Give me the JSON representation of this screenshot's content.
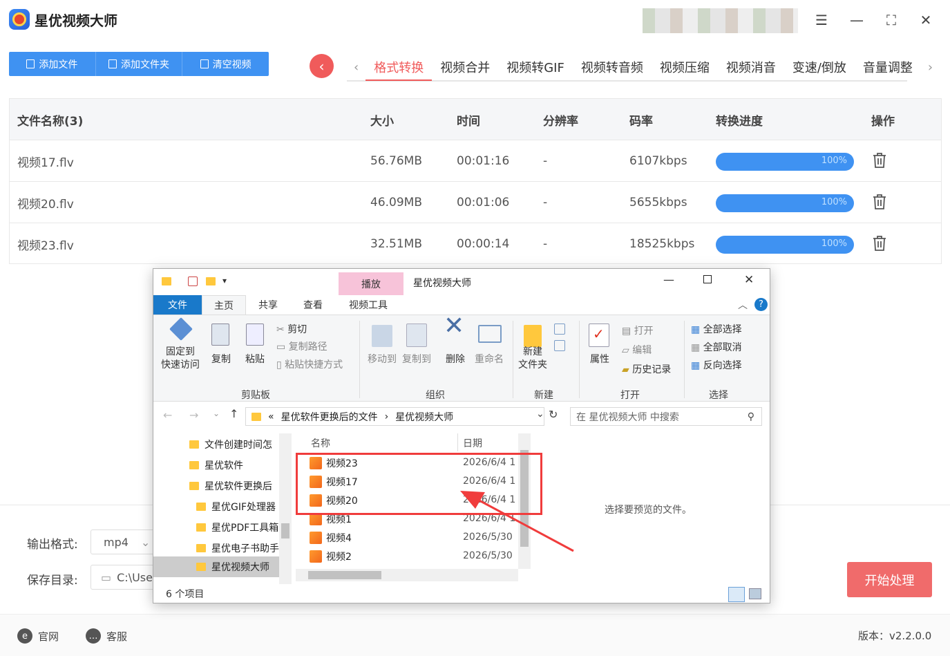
{
  "app": {
    "title": "星优视频大师",
    "version": "版本：v2.2.0.0"
  },
  "toolbar": {
    "add_file": "添加文件",
    "add_folder": "添加文件夹",
    "clear": "清空视频"
  },
  "tabs": [
    "格式转换",
    "视频合并",
    "视频转GIF",
    "视频转音频",
    "视频压缩",
    "视频消音",
    "变速/倒放",
    "音量调整"
  ],
  "table": {
    "headers": [
      "文件名称(3)",
      "大小",
      "时间",
      "分辨率",
      "码率",
      "转换进度",
      "操作"
    ],
    "rows": [
      {
        "name": "视频17.flv",
        "size": "56.76MB",
        "time": "00:01:16",
        "res": "-",
        "bitrate": "6107kbps",
        "progress": "100%"
      },
      {
        "name": "视频20.flv",
        "size": "46.09MB",
        "time": "00:01:06",
        "res": "-",
        "bitrate": "5655kbps",
        "progress": "100%"
      },
      {
        "name": "视频23.flv",
        "size": "32.51MB",
        "time": "00:00:14",
        "res": "-",
        "bitrate": "18525kbps",
        "progress": "100%"
      }
    ]
  },
  "bottom": {
    "format_label": "输出格式:",
    "format_value": "mp4",
    "dir_label": "保存目录:",
    "dir_value": "C:\\Use",
    "start": "开始处理"
  },
  "footer": {
    "site": "官网",
    "service": "客服"
  },
  "explorer": {
    "title": "星优视频大师",
    "play_tab": "播放",
    "ribbon_tabs": [
      "文件",
      "主页",
      "共享",
      "查看",
      "视频工具"
    ],
    "ribbon": {
      "pin": "固定到\n快速访问",
      "copy": "复制",
      "paste": "粘贴",
      "cut": "剪切",
      "copy_path": "复制路径",
      "paste_shortcut": "粘贴快捷方式",
      "move_to": "移动到",
      "copy_to": "复制到",
      "delete": "删除",
      "rename": "重命名",
      "new_folder": "新建\n文件夹",
      "properties": "属性",
      "open": "打开",
      "edit": "编辑",
      "history": "历史记录",
      "select_all": "全部选择",
      "select_none": "全部取消",
      "invert": "反向选择",
      "groups": [
        "剪贴板",
        "组织",
        "新建",
        "打开",
        "选择"
      ]
    },
    "address": {
      "prefix": "«",
      "crumb1": "星优软件更换后的文件",
      "sep": "›",
      "crumb2": "星优视频大师"
    },
    "search_placeholder": "在 星优视频大师 中搜索",
    "nav": [
      "文件创建时间怎",
      "星优软件",
      "星优软件更换后",
      "星优GIF处理器",
      "星优PDF工具箱",
      "星优电子书助手",
      "星优视频大师"
    ],
    "columns": {
      "name": "名称",
      "date": "日期"
    },
    "files": [
      {
        "name": "视频23",
        "date": "2026/6/4 1"
      },
      {
        "name": "视频17",
        "date": "2026/6/4 1"
      },
      {
        "name": "视频20",
        "date": "2026/6/4 1"
      },
      {
        "name": "视频1",
        "date": "2026/6/4 1"
      },
      {
        "name": "视频4",
        "date": "2026/5/30"
      },
      {
        "name": "视频2",
        "date": "2026/5/30"
      }
    ],
    "preview": "选择要预览的文件。",
    "status": "6 个项目"
  }
}
